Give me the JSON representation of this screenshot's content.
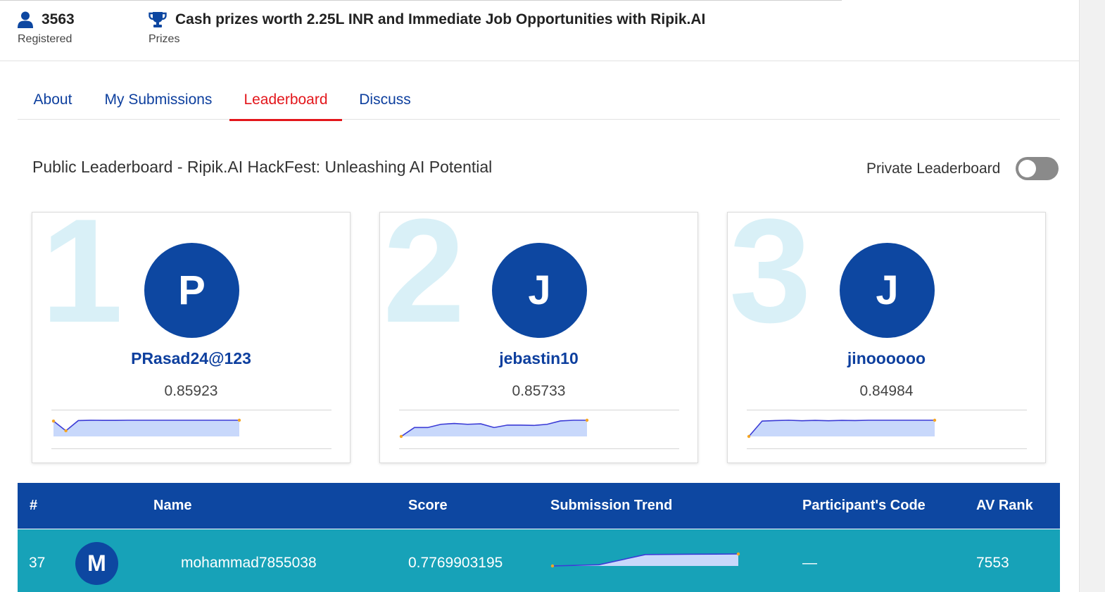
{
  "stats": {
    "registered": {
      "icon": "user-icon",
      "value": "3563",
      "label": "Registered"
    },
    "prizes": {
      "icon": "trophy-icon",
      "value": "Cash prizes worth 2.25L INR and Immediate Job Opportunities with Ripik.AI",
      "label": "Prizes"
    }
  },
  "tabs": [
    {
      "label": "About",
      "active": false
    },
    {
      "label": "My Submissions",
      "active": false
    },
    {
      "label": "Leaderboard",
      "active": true
    },
    {
      "label": "Discuss",
      "active": false
    }
  ],
  "leaderboard": {
    "title": "Public Leaderboard - Ripik.AI HackFest: Unleashing AI Potential",
    "private_toggle_label": "Private Leaderboard",
    "private_toggle_on": false
  },
  "top3": [
    {
      "rank": "1",
      "initial": "P",
      "username": "PRasad24@123",
      "score": "0.85923",
      "trend": [
        0.95,
        0.35,
        0.98,
        1.0,
        0.99,
        0.99,
        1.0,
        1.0,
        1.0,
        1.0,
        1.0,
        1.0,
        1.0,
        1.0,
        1.0,
        1.0
      ]
    },
    {
      "rank": "2",
      "initial": "J",
      "username": "jebastin10",
      "score": "0.85733",
      "trend": [
        0.0,
        0.55,
        0.55,
        0.75,
        0.8,
        0.75,
        0.78,
        0.55,
        0.7,
        0.7,
        0.68,
        0.75,
        0.96,
        1.0,
        1.0
      ]
    },
    {
      "rank": "3",
      "initial": "J",
      "username": "jinoooooo",
      "score": "0.84984",
      "trend": [
        0.0,
        0.95,
        0.98,
        1.0,
        0.97,
        0.99,
        0.97,
        0.99,
        0.98,
        1.0,
        1.0,
        1.0,
        1.0,
        1.0,
        1.0
      ]
    }
  ],
  "table": {
    "headers": {
      "num": "#",
      "name": "Name",
      "score": "Score",
      "trend": "Submission Trend",
      "code": "Participant's Code",
      "rank": "AV Rank"
    },
    "rows": [
      {
        "num": "37",
        "initial": "M",
        "name": "mohammad7855038",
        "score": "0.7769903195",
        "code": "—",
        "av_rank": "7553",
        "trend": [
          0.0,
          0.1,
          0.95,
          0.98,
          1.0
        ]
      }
    ]
  },
  "colors": {
    "brand": "#0d47a1",
    "active_tab": "#e3161b",
    "row_highlight": "#17a2b8",
    "trend_line": "#3b3bd6",
    "trend_fill": "#c8d8fb",
    "trend_marker": "#f5a623"
  }
}
